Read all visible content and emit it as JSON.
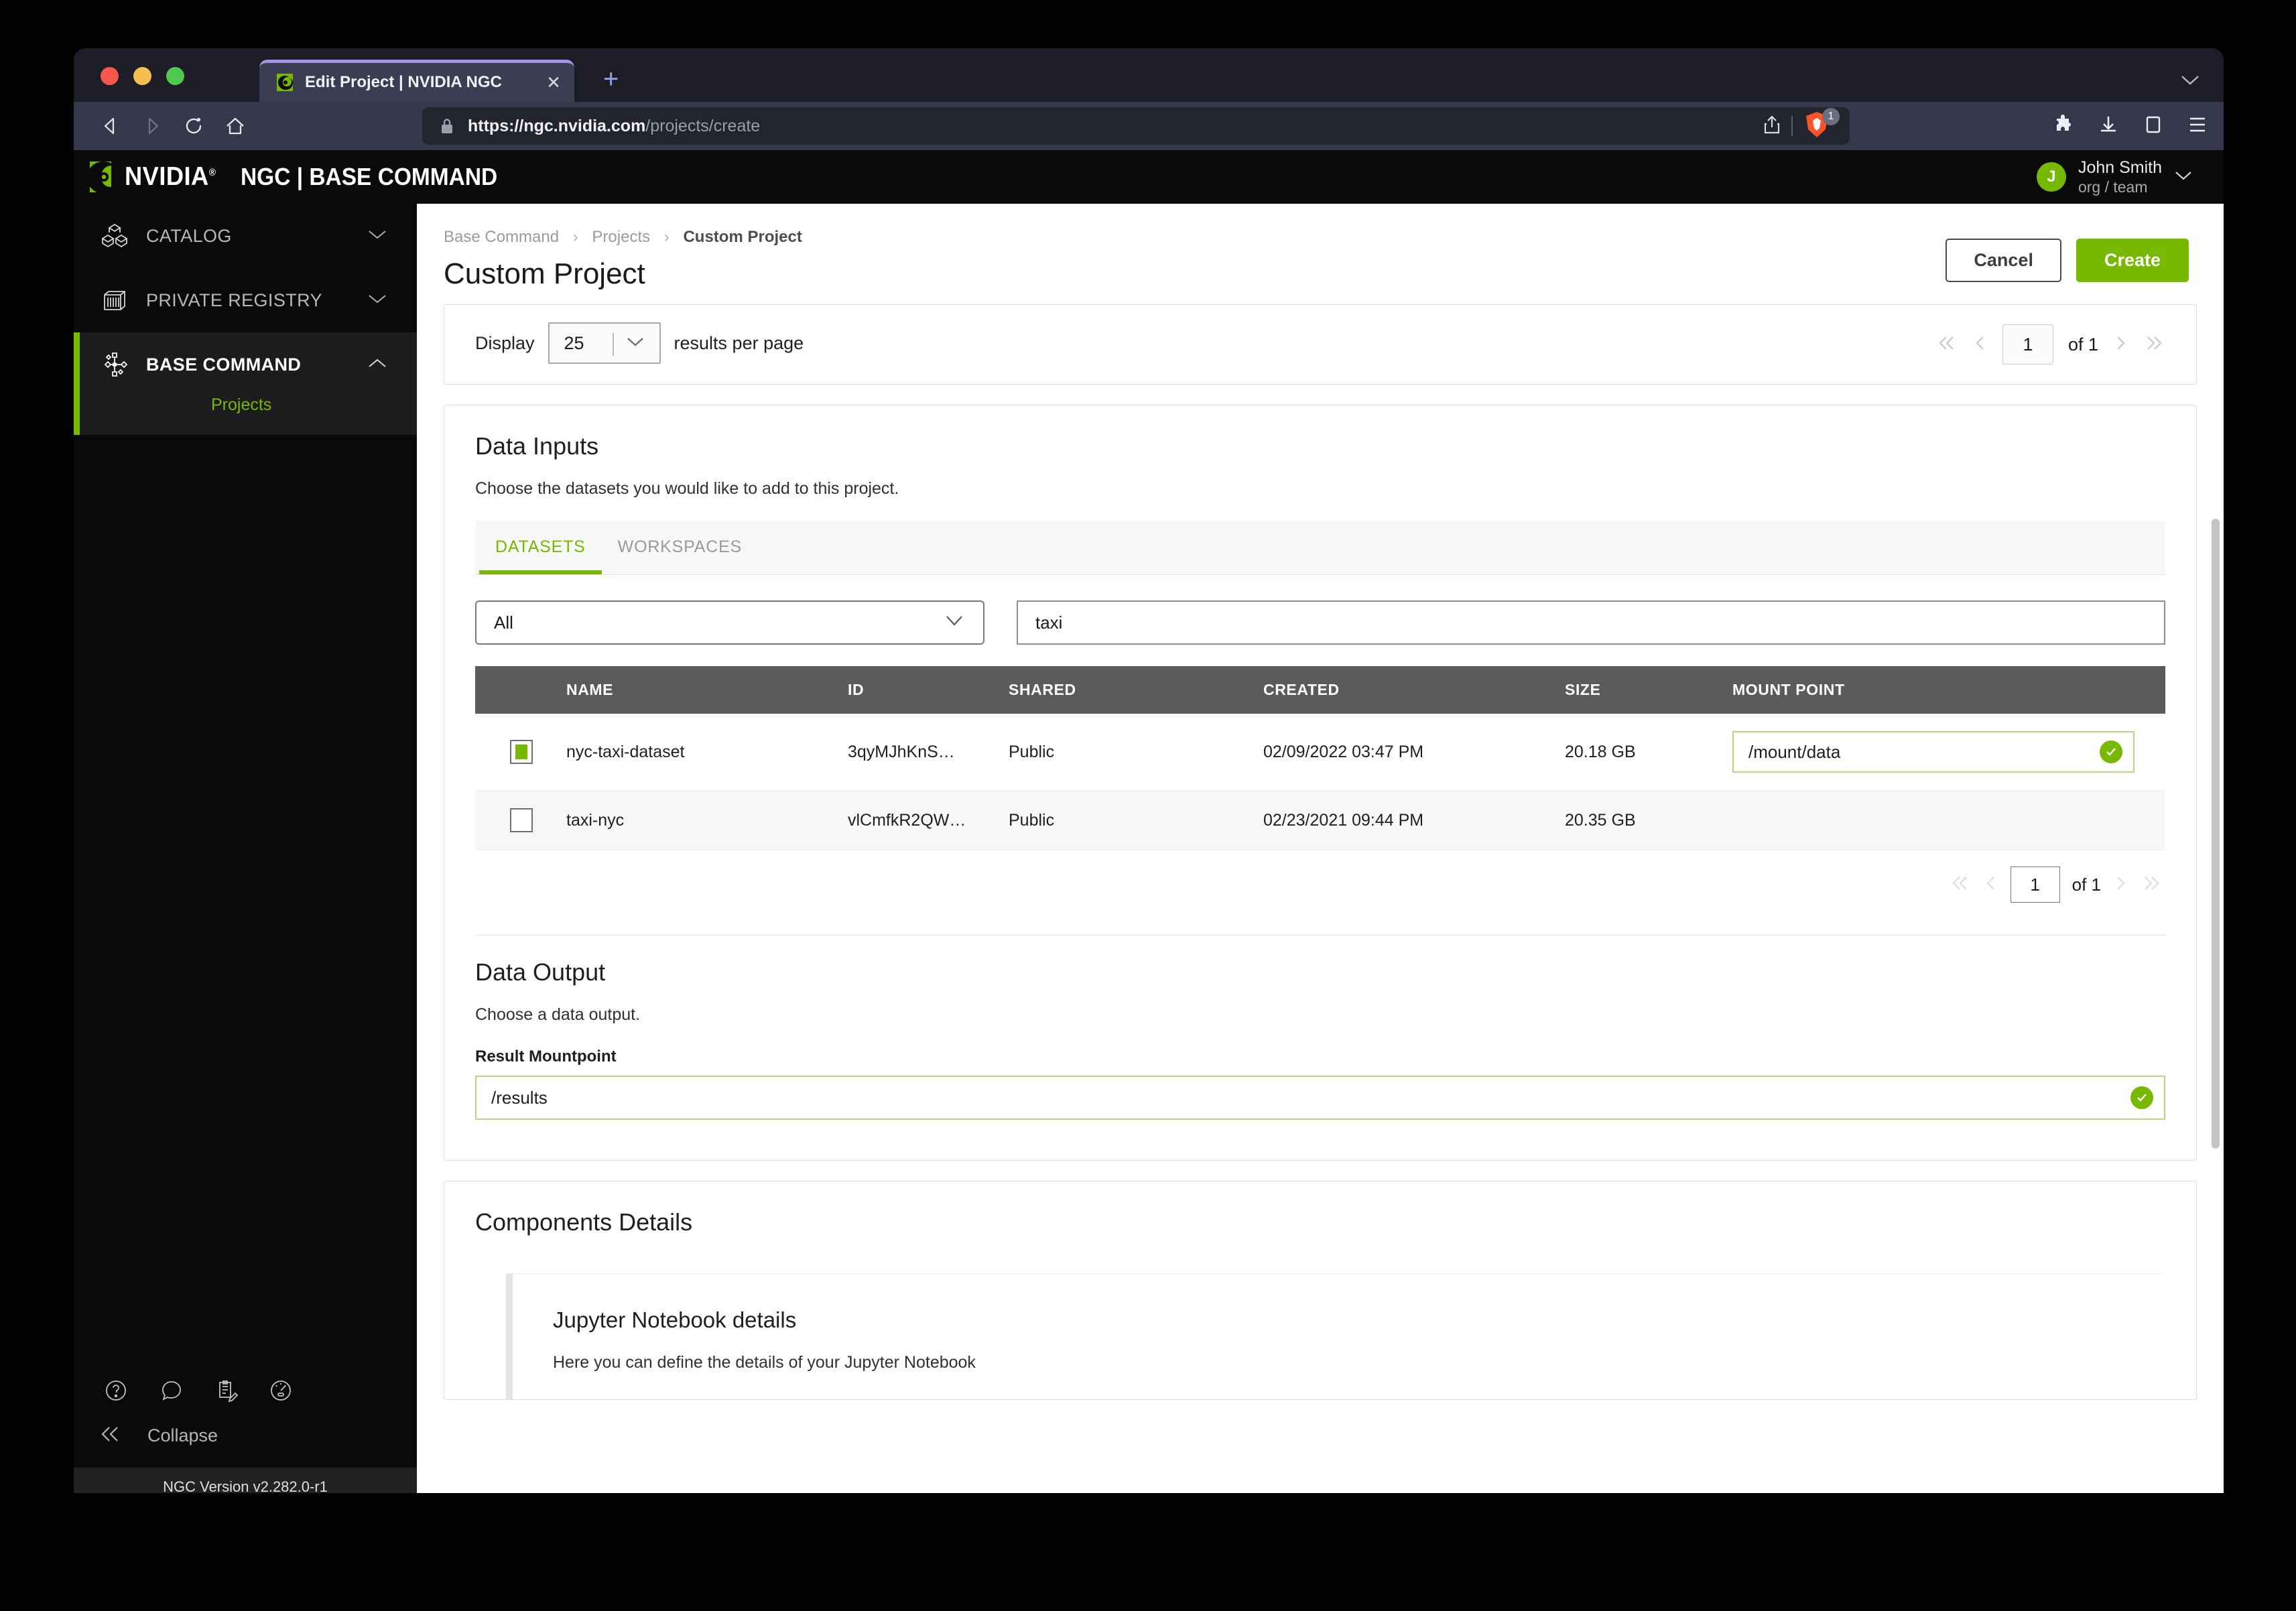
{
  "browser": {
    "tab": {
      "title": "Edit Project | NVIDIA NGC",
      "close_label": "✕",
      "favicon": "nvidia-favicon"
    },
    "new_tab_label": "+",
    "url": {
      "host": "https://ngc.nvidia.com",
      "path": "/projects/create"
    },
    "shield_count": "1",
    "icons": {
      "back": "back-arrow-icon",
      "forward": "forward-arrow-icon",
      "reload": "reload-icon",
      "home": "home-icon",
      "lock": "lock-icon",
      "share": "share-icon",
      "brave_shield": "brave-shield-icon",
      "extensions": "puzzle-piece-icon",
      "downloads": "download-icon",
      "sidepanel": "side-panel-icon",
      "menu": "hamburger-menu-icon"
    }
  },
  "header": {
    "brand": "NVIDIA",
    "brand_reg": "®",
    "product": "NGC | BASE COMMAND",
    "user": {
      "initial": "J",
      "name": "John Smith",
      "org": "org / team"
    }
  },
  "sidebar": {
    "items": [
      {
        "label": "CATALOG",
        "icon": "cubes-icon",
        "chevron": "chevron-down-icon",
        "active": false
      },
      {
        "label": "PRIVATE REGISTRY",
        "icon": "container-icon",
        "chevron": "chevron-down-icon",
        "active": false
      },
      {
        "label": "BASE COMMAND",
        "icon": "network-nodes-icon",
        "chevron": "chevron-up-icon",
        "active": true
      }
    ],
    "sub_items": [
      {
        "label": "Projects"
      }
    ],
    "bottom_icons": [
      "help-circle-icon",
      "chat-bubble-icon",
      "clipboard-edit-icon",
      "speedometer-icon"
    ],
    "collapse_label": "Collapse",
    "collapse_icon": "chevrons-left-icon",
    "version": "NGC Version v2.282.0-r1"
  },
  "main": {
    "breadcrumb": {
      "items": [
        "Base Command",
        "Projects"
      ],
      "current": "Custom Project",
      "separator": "›"
    },
    "title": "Custom Project",
    "buttons": {
      "cancel": "Cancel",
      "create": "Create"
    }
  },
  "display_card": {
    "display_label": "Display",
    "per_page_value": "25",
    "suffix_label": "results per page",
    "pager": {
      "first": "«",
      "prev": "‹",
      "page": "1",
      "of": "of 1",
      "next": "›",
      "last": "»"
    }
  },
  "data_inputs": {
    "title": "Data Inputs",
    "subtitle": "Choose the datasets you would like to add to this project.",
    "tabs": [
      {
        "label": "DATASETS",
        "active": true
      },
      {
        "label": "WORKSPACES",
        "active": false
      }
    ],
    "filter": {
      "value": "All",
      "chevron": "chevron-down-icon"
    },
    "search": {
      "value": "taxi",
      "placeholder": ""
    },
    "table": {
      "columns": [
        "NAME",
        "ID",
        "SHARED",
        "CREATED",
        "SIZE",
        "MOUNT POINT"
      ],
      "rows": [
        {
          "selected": true,
          "name": "nyc-taxi-dataset",
          "id": "3qyMJhKnS…",
          "shared": "Public",
          "created": "02/09/2022 03:47 PM",
          "size": "20.18 GB",
          "mount_point": "/mount/data",
          "mount_valid": true
        },
        {
          "selected": false,
          "name": "taxi-nyc",
          "id": "vlCmfkR2QW…",
          "shared": "Public",
          "created": "02/23/2021 09:44 PM",
          "size": "20.35 GB",
          "mount_point": "",
          "mount_valid": false
        }
      ]
    },
    "pager": {
      "first": "«",
      "prev": "‹",
      "page": "1",
      "of": "of 1",
      "next": "›",
      "last": "»"
    }
  },
  "data_output": {
    "title": "Data Output",
    "subtitle": "Choose a data output.",
    "field_label": "Result Mountpoint",
    "value": "/results",
    "valid": true
  },
  "components": {
    "title": "Components Details",
    "jupyter": {
      "title": "Jupyter Notebook details",
      "subtitle": "Here you can define the details of your Jupyter Notebook"
    }
  },
  "colors": {
    "nvidia_green": "#76b900",
    "header_black": "#0a0a0a",
    "table_header_gray": "#5b5b5b",
    "accent_tab": "#a692e8"
  }
}
